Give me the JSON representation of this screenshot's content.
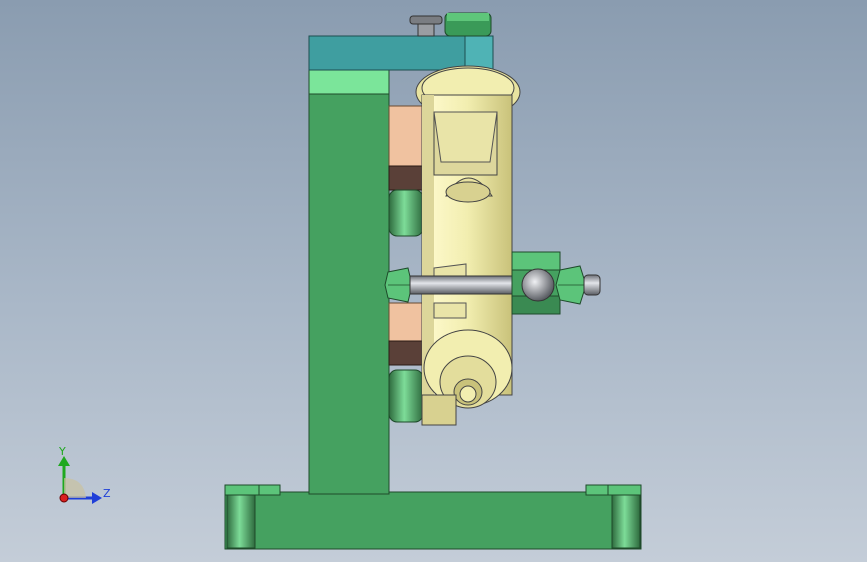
{
  "viewport": {
    "background_top": "#8a9cb0",
    "background_bottom": "#c4cdd8"
  },
  "model": {
    "frame_color": "#45a160",
    "frame_highlight": "#6fd18a",
    "top_plate_color": "#3f9ea0",
    "cylinder_color": "#f2eeb0",
    "copper_color": "#f0c2a0",
    "dark_spacer_color": "#5a4038",
    "rod_color": "#b8bcc4"
  },
  "triad": {
    "x_label": "",
    "y_label": "Y",
    "z_label": "Z",
    "y_color": "#1fa81f",
    "z_color": "#1f3fd8",
    "x_color": "#d81f1f"
  }
}
